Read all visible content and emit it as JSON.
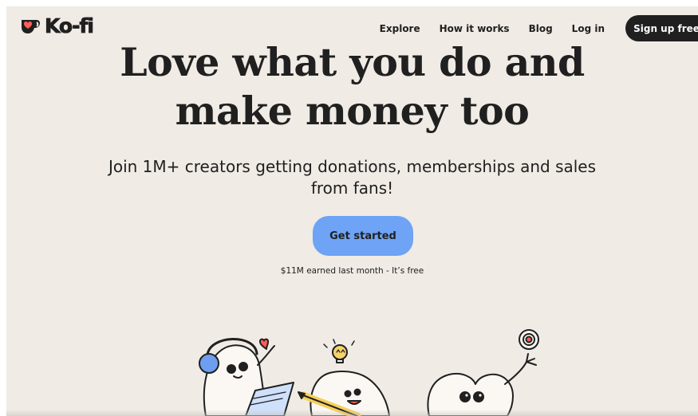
{
  "brand": {
    "name": "Ko-fi",
    "heart_color": "#ff5e5b"
  },
  "nav": {
    "links": [
      "Explore",
      "How it works",
      "Blog",
      "Log in"
    ],
    "signup_label": "Sign up free"
  },
  "hero": {
    "headline_line1": "Love what you do and",
    "headline_line2": "make money too",
    "subhead_line1": "Join 1M+ creators getting donations, memberships and sales",
    "subhead_line2": "from fans!",
    "cta_label": "Get started",
    "stat": "$11M earned last month - It’s free"
  },
  "colors": {
    "background": "#f0ebe5",
    "cta": "#6ea3f5",
    "dark": "#202020",
    "headphones": "#6e9ef0"
  }
}
